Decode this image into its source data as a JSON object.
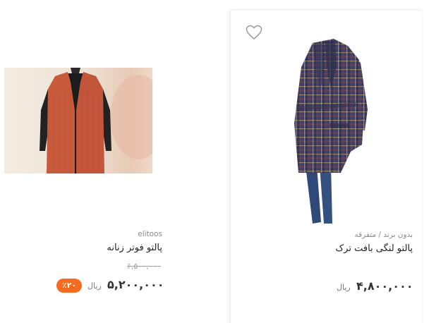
{
  "products": [
    {
      "brand": "elitoos",
      "title": "پالتو فوتر زنانه",
      "old_price": "۶,۵۰۰,۰۰۰",
      "price": "۵,۲۰۰,۰۰۰",
      "currency": "ریال",
      "discount": "٪۲۰",
      "image": "coat-orange-image"
    },
    {
      "brand": "بدون برند / متفرقه",
      "title": "پالتو لنگی بافت ترک",
      "price": "۴,۸۰۰,۰۰۰",
      "currency": "ریال",
      "image": "coat-plaid-image",
      "favorite_icon": "heart-outline-icon"
    }
  ],
  "colors": {
    "badge": "#f36c1f",
    "coat_orange": "#c85a3c",
    "coat_plaid": "#3a3b5e"
  }
}
